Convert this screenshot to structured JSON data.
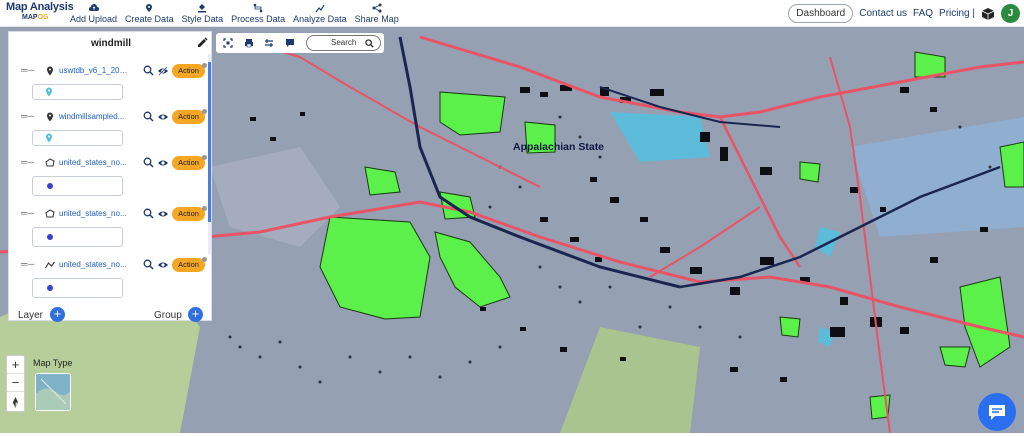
{
  "app": {
    "logo_title": "Map Analysis",
    "logo_sub_a": "MAP",
    "logo_sub_b": "OG"
  },
  "nav": [
    {
      "label": "Add Upload",
      "icon": "cloud-upload-icon"
    },
    {
      "label": "Create Data",
      "icon": "map-pin-icon"
    },
    {
      "label": "Style Data",
      "icon": "paint-bucket-icon"
    },
    {
      "label": "Process Data",
      "icon": "process-icon"
    },
    {
      "label": "Analyze Data",
      "icon": "analyze-icon"
    },
    {
      "label": "Share Map",
      "icon": "share-icon"
    }
  ],
  "right_nav": {
    "dashboard": "Dashboard",
    "contact": "Contact us",
    "faq": "FAQ",
    "pricing": "Pricing |",
    "avatar": "J"
  },
  "panel": {
    "title": "windmill",
    "layers": [
      {
        "name": "uswtdb_v6_1_2020...",
        "geometry": "point",
        "visibility": "hidden",
        "action": "Action"
      },
      {
        "name": "windmillsampled...",
        "geometry": "point",
        "visibility": "visible",
        "action": "Action"
      },
      {
        "name": "united_states_no...",
        "geometry": "polygon",
        "visibility": "visible",
        "action": "Action"
      },
      {
        "name": "united_states_no...",
        "geometry": "polygon",
        "visibility": "visible",
        "action": "Action"
      },
      {
        "name": "united_states_no...",
        "geometry": "line",
        "visibility": "visible",
        "action": "Action"
      }
    ],
    "layer_label": "Layer",
    "group_label": "Group"
  },
  "maptools": {
    "search_label": "Search"
  },
  "map": {
    "place_label": "Appalachian State",
    "map_type_label": "Map Type",
    "colors": {
      "land": "#95a0b3",
      "green": "#5cf04a",
      "road": "#e85466",
      "water": "#54bfe0",
      "building": "#0d0d14"
    }
  },
  "zoom": {
    "in": "+",
    "out": "−"
  }
}
